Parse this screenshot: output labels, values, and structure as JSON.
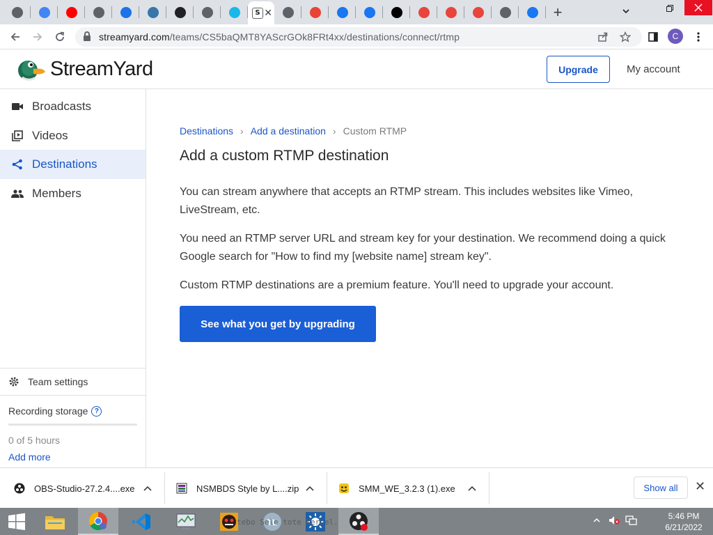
{
  "browser": {
    "tabs": [
      {
        "icon": "globe-icon",
        "color": "#5f6368"
      },
      {
        "icon": "google-icon",
        "color": "#4285f4"
      },
      {
        "icon": "youtube-icon",
        "color": "#ff0000"
      },
      {
        "icon": "globe-icon",
        "color": "#5f6368"
      },
      {
        "icon": "link-icon",
        "color": "#1a73e8"
      },
      {
        "icon": "python-icon",
        "color": "#3776ab"
      },
      {
        "icon": "github-icon",
        "color": "#202124"
      },
      {
        "icon": "globe-icon",
        "color": "#5f6368"
      },
      {
        "icon": "vimeo-icon",
        "color": "#1ab7ea"
      },
      {
        "icon": "streamyard-icon",
        "color": "#5f6368",
        "active": true,
        "label": "S"
      },
      {
        "icon": "chrome-icon",
        "color": "#5f6368"
      },
      {
        "icon": "gmail-icon",
        "color": "#ea4335"
      },
      {
        "icon": "facebook-icon",
        "color": "#1877f2"
      },
      {
        "icon": "facebook-icon",
        "color": "#1877f2"
      },
      {
        "icon": "tiktok-icon",
        "color": "#000000"
      },
      {
        "icon": "play-icon",
        "color": "#e8453c"
      },
      {
        "icon": "play-icon",
        "color": "#e8453c"
      },
      {
        "icon": "play-icon",
        "color": "#e8453c"
      },
      {
        "icon": "chrome-icon",
        "color": "#5f6368"
      },
      {
        "icon": "facebook-icon",
        "color": "#1877f2"
      }
    ],
    "tab_close_glyph": "✕",
    "new_tab_glyph": "+",
    "url_host": "streamyard.com",
    "url_path": "/teams/CS5baQMT8YAScrGOk8FRt4xx/destinations/connect/rtmp",
    "profile_initial": "C"
  },
  "header": {
    "logo_text": "StreamYard",
    "upgrade_label": "Upgrade",
    "my_account_label": "My account"
  },
  "sidebar": {
    "items": [
      {
        "label": "Broadcasts",
        "icon": "video-camera-icon"
      },
      {
        "label": "Videos",
        "icon": "video-library-icon"
      },
      {
        "label": "Destinations",
        "icon": "share-icon",
        "active": true
      },
      {
        "label": "Members",
        "icon": "people-icon"
      }
    ],
    "team_settings_label": "Team settings",
    "recording_storage_label": "Recording storage",
    "storage_used_label": "0 of 5 hours",
    "storage_fraction": 0,
    "add_more_label": "Add more"
  },
  "main": {
    "breadcrumb": {
      "item1": "Destinations",
      "item2": "Add a destination",
      "current": "Custom RTMP",
      "separator": "›"
    },
    "title": "Add a custom RTMP destination",
    "paragraph1": "You can stream anywhere that accepts an RTMP stream. This includes websites like Vimeo, LiveStream, etc.",
    "paragraph2": "You need an RTMP server URL and stream key for your destination. We recommend doing a quick Google search for \"How to find my [website name] stream key\".",
    "paragraph3": "Custom RTMP destinations are a premium feature. You'll need to upgrade your account.",
    "cta_label": "See what you get by upgrading"
  },
  "downloads": {
    "items": [
      {
        "name": "OBS-Studio-27.2.4....exe",
        "icon": "obs-icon"
      },
      {
        "name": "NSMBDS Style by L....zip",
        "icon": "winrar-icon"
      },
      {
        "name": "SMM_WE_3.2.3 (1).exe",
        "icon": "smm-icon"
      }
    ],
    "show_all_label": "Show all",
    "close_glyph": "✕"
  },
  "taskbar": {
    "time": "5:46 PM",
    "date": "6/21/2022",
    "ghost_text": "tebo   Sele   tote   Kernel."
  }
}
